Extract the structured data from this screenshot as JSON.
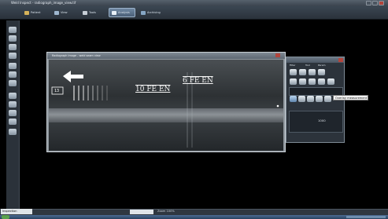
{
  "window": {
    "title": "Weld Inspect  -  radiograph_image_view.tif"
  },
  "ribbon": {
    "tabs": [
      {
        "label": "Patient",
        "icon": "folder-icon"
      },
      {
        "label": "View",
        "icon": "view-icon"
      },
      {
        "label": "Tools",
        "icon": "tools-icon"
      },
      {
        "label": "Analysis",
        "icon": "analysis-icon"
      },
      {
        "label": "Archiving",
        "icon": "archive-icon"
      }
    ],
    "active_index": 3
  },
  "image_window": {
    "title": "Radiograph image - weld seam view",
    "labels": {
      "iqi_tag": "13",
      "marker_left": "10 FE EN",
      "marker_right": "6 FE EN"
    }
  },
  "panel": {
    "tabs": [
      "Filter",
      "Tool",
      "Param"
    ],
    "tooltip": "Overlay measurement",
    "readout_value": "1000"
  },
  "status": {
    "field": "Inspection",
    "zoom": "Zoom 100%"
  },
  "colors": {
    "accent": "#5f7892",
    "tooltip_bg": "#f1f1f1"
  }
}
